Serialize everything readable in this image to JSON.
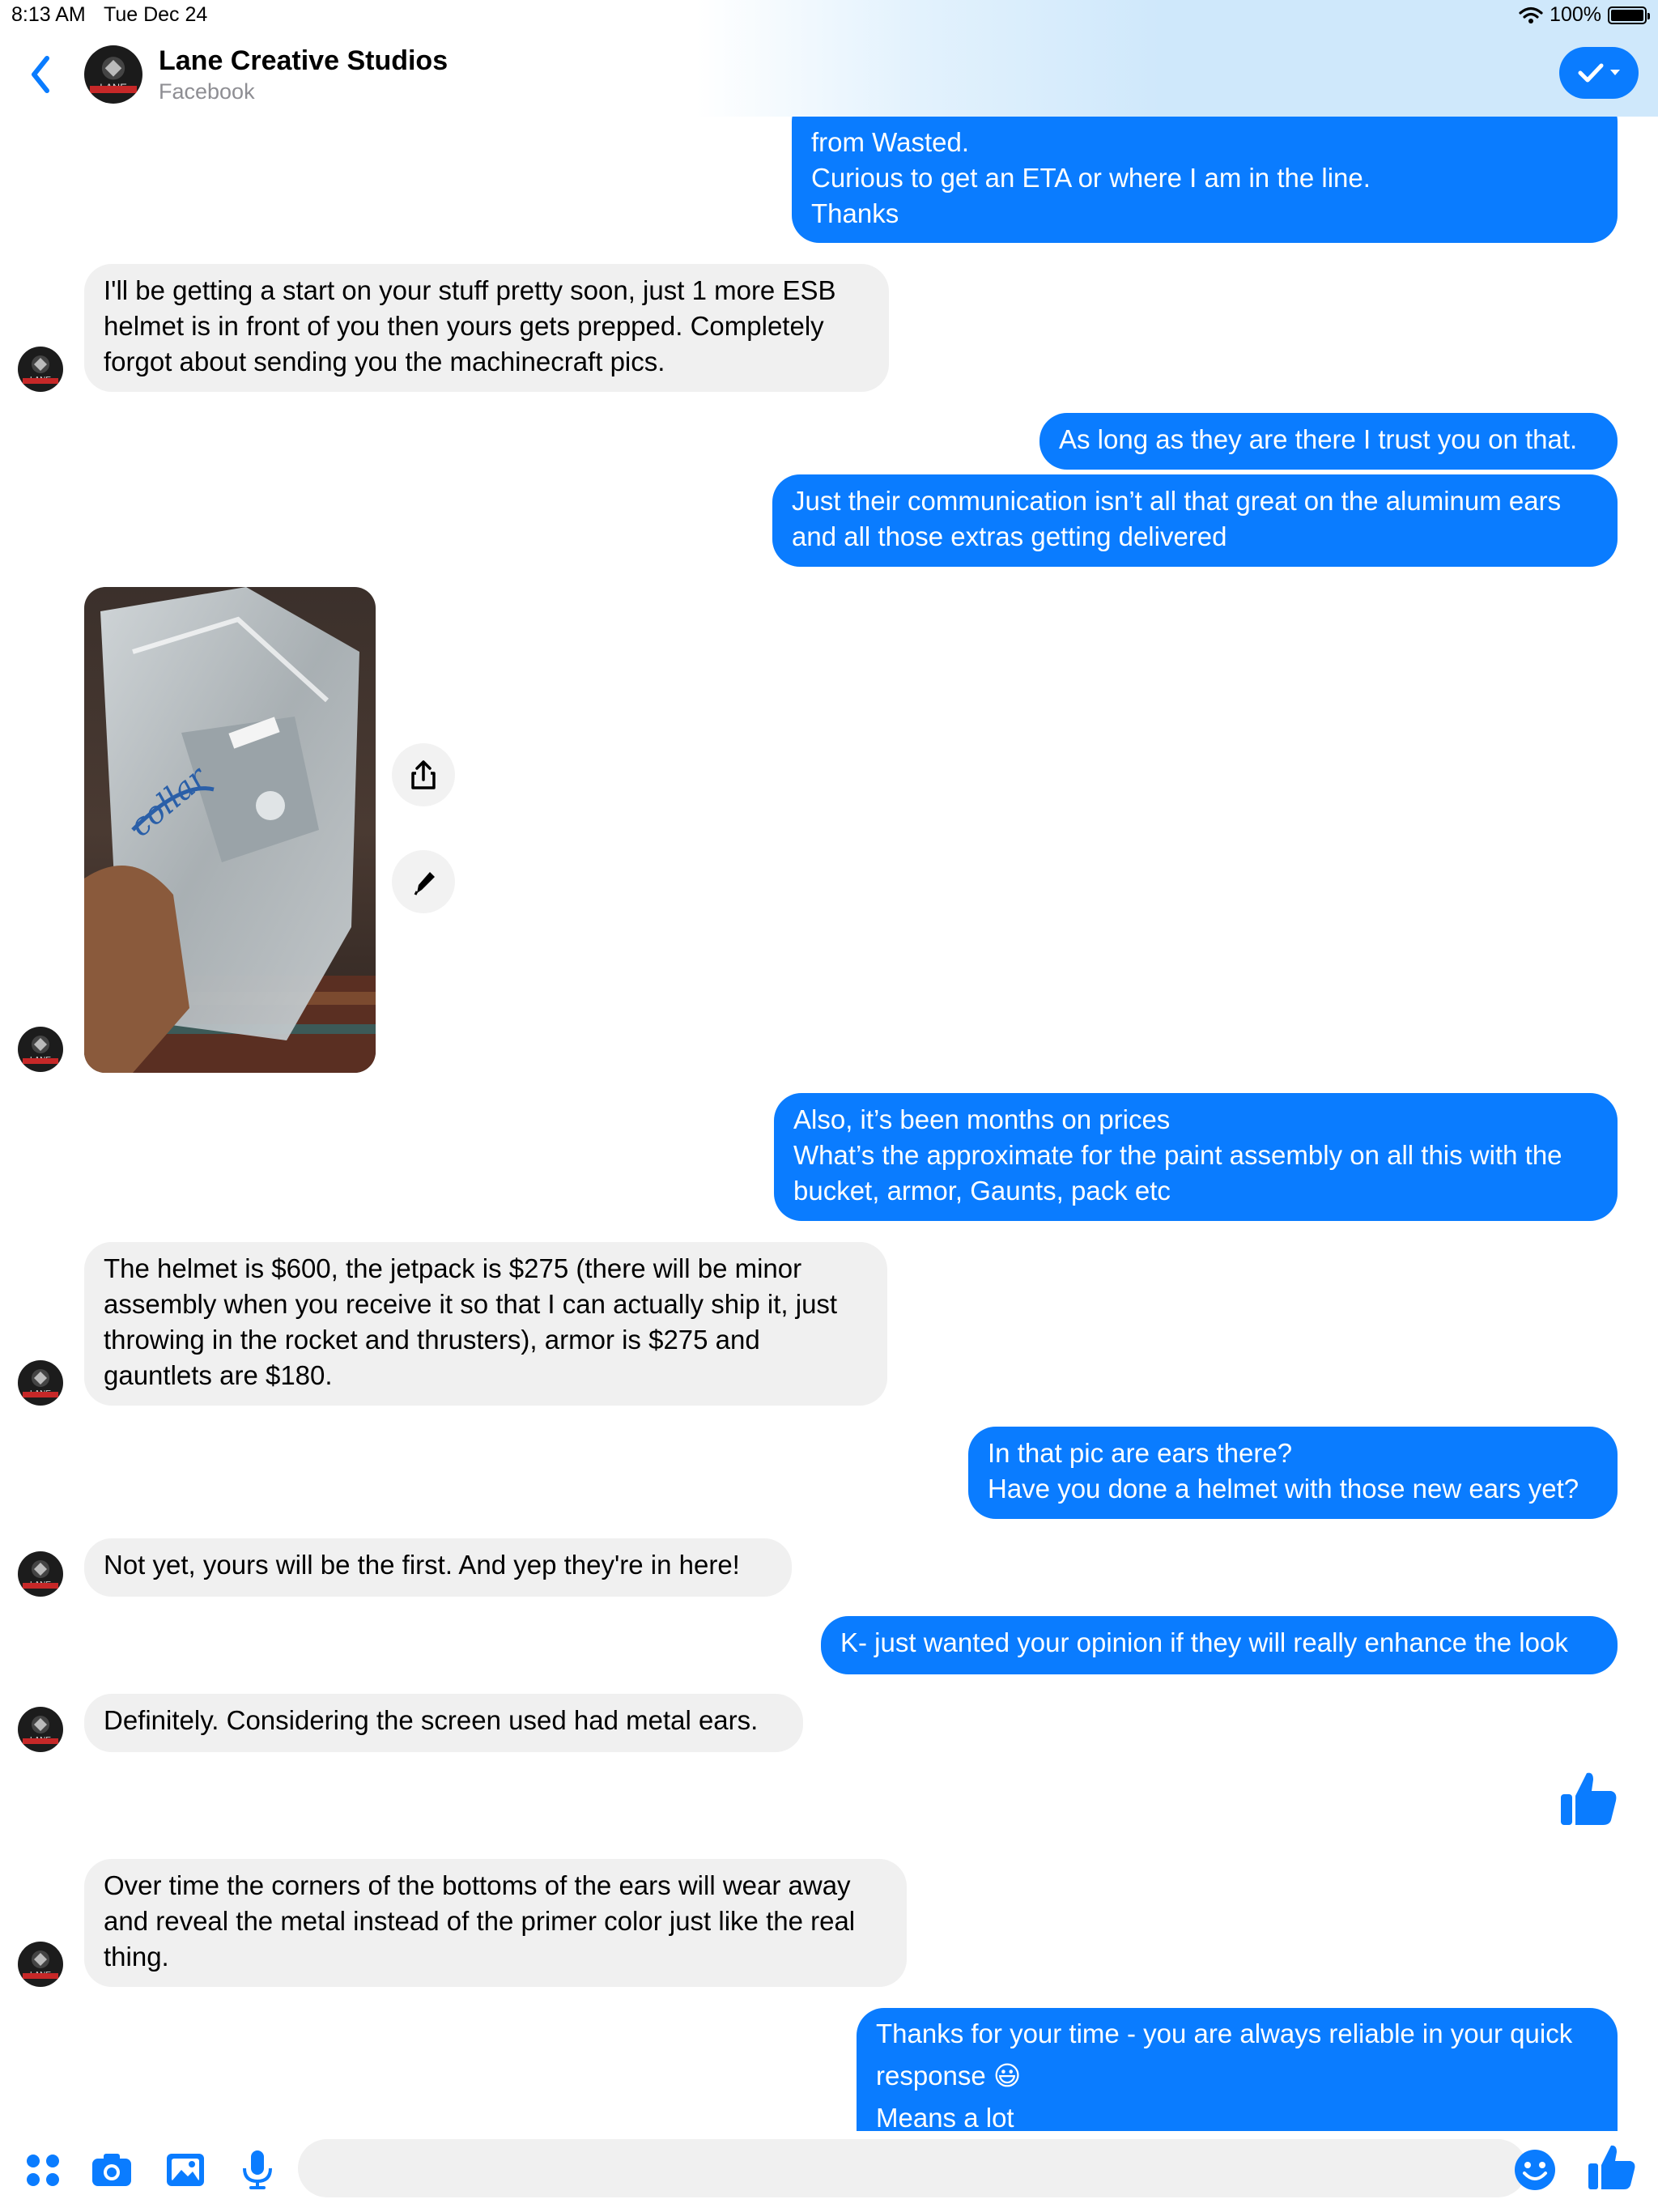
{
  "status_bar": {
    "time": "8:13 AM",
    "date": "Tue Dec 24",
    "battery": "100%"
  },
  "header": {
    "title": "Lane Creative Studios",
    "subtitle": "Facebook"
  },
  "colors": {
    "accent": "#0a7cff",
    "incoming_bubble": "#f0f0f0",
    "avatar_bg": "#1c1c1c",
    "logo_band": "#c62828"
  },
  "messages": [
    {
      "from": "me",
      "text": "from Wasted.\nCurious to get an ETA or where I am in the line.\nThanks"
    },
    {
      "from": "them",
      "text": "I'll be getting a start on your stuff pretty soon, just 1 more ESB\nhelmet is in front of you then yours gets prepped. Completely\nforgot about sending you the machinecraft pics."
    },
    {
      "from": "me",
      "text": "As long as they are there I trust you on that."
    },
    {
      "from": "me",
      "text": "Just their communication isn’t all that great on the aluminum ears\nand all those extras getting delivered"
    },
    {
      "from": "them",
      "type": "photo",
      "photo_text": "collar"
    },
    {
      "from": "me",
      "text": "Also, it’s been months on prices\nWhat’s the approximate for the paint assembly on all this with the\nbucket, armor, Gaunts, pack etc"
    },
    {
      "from": "them",
      "text": "The helmet is $600, the jetpack is $275 (there will be minor\nassembly when you receive it so that I can actually ship it, just\nthrowing in the rocket and thrusters), armor is $275 and\ngauntlets are $180."
    },
    {
      "from": "me",
      "text": "In that pic are ears there?\nHave you done a helmet with those new ears yet?"
    },
    {
      "from": "them",
      "text": "Not yet, yours will be the first. And yep they're in here!"
    },
    {
      "from": "me",
      "text": "K- just wanted your opinion if they will really enhance the look"
    },
    {
      "from": "them",
      "text": "Definitely. Considering the screen used had metal ears."
    },
    {
      "from": "me",
      "type": "like"
    },
    {
      "from": "them",
      "text": "Over time the corners of the bottoms of the ears will wear away\nand reveal the metal instead of the primer color just like the real\nthing."
    },
    {
      "from": "me",
      "text": "Thanks for your time - you are always reliable in your quick\nresponse 😃\nMeans a lot"
    }
  ],
  "icons": {
    "back": "chevron-left-icon",
    "header_action": "checkmark-dropdown-icon",
    "share": "share-icon",
    "edit": "pencil-icon",
    "apps": "apps-grid-icon",
    "camera": "camera-icon",
    "gallery": "photo-icon",
    "mic": "microphone-icon",
    "emoji": "emoji-icon",
    "like": "thumbs-up-icon"
  },
  "composer": {
    "placeholder": ""
  }
}
